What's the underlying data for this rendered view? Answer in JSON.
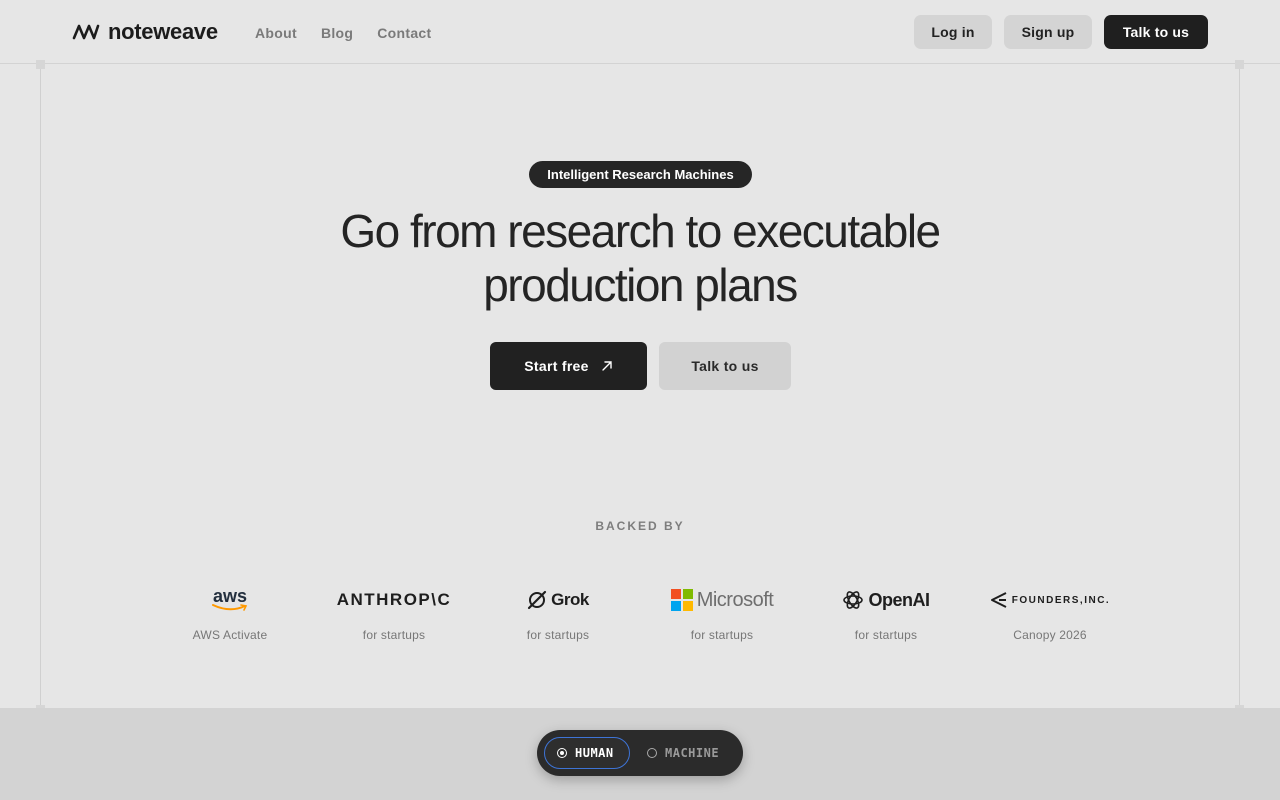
{
  "header": {
    "brand": "noteweave",
    "nav": [
      "About",
      "Blog",
      "Contact"
    ],
    "login_label": "Log in",
    "signup_label": "Sign up",
    "talk_label": "Talk to us"
  },
  "hero": {
    "pill": "Intelligent Research Machines",
    "headline_line1": "Go from research to executable",
    "headline_line2": "production plans",
    "start_label": "Start free",
    "talk_label": "Talk to us"
  },
  "backed": {
    "heading": "BACKED BY",
    "sponsors": [
      {
        "name": "aws",
        "caption": "AWS Activate"
      },
      {
        "name": "ANTHROP\\C",
        "caption": "for startups"
      },
      {
        "name": "Grok",
        "caption": "for startups"
      },
      {
        "name": "Microsoft",
        "caption": "for startups"
      },
      {
        "name": "OpenAI",
        "caption": "for startups"
      },
      {
        "name": "FOUNDERS,INC.",
        "caption": "Canopy 2026"
      }
    ]
  },
  "toggle": {
    "human_label": "HUMAN",
    "machine_label": "MACHINE",
    "selected": "HUMAN"
  },
  "colors": {
    "background": "#e6e6e6",
    "dark_button": "#1f1f1f",
    "light_button": "#d4d4d4",
    "toggle_accent": "#3e74d6"
  }
}
